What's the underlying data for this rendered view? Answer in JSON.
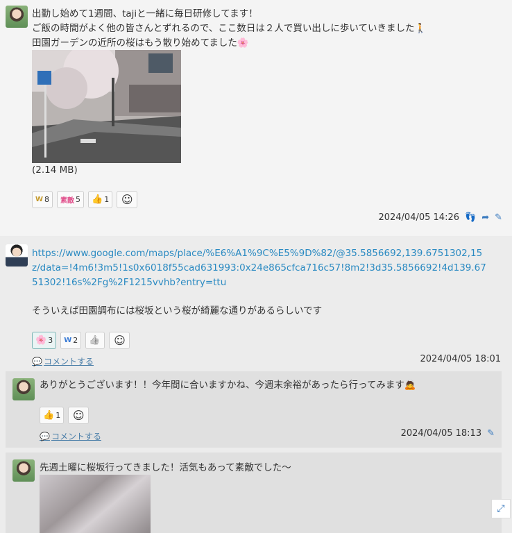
{
  "post1": {
    "lines": [
      "出勤し始めて1週間、tajiと一緒に毎日研修してます！",
      "ご飯の時間がよく他の皆さんとずれるので、ここ数日は２人で買い出しに歩いていきました🚶",
      "田園ガーデンの近所の桜はもう散り始めてました🌸"
    ],
    "file_size": "(2.14 MB)",
    "reactions": [
      {
        "emoji": "W",
        "count": "8"
      },
      {
        "emoji": "素敵",
        "count": "5"
      },
      {
        "emoji": "👍",
        "count": "1"
      }
    ],
    "add_reaction": "☺",
    "timestamp": "2024/04/05 14:26"
  },
  "post2": {
    "url": [
      "https://www.google.com/maps/place/%E6%A1%9C%E5%9D%82/@35.5856692,139.6751302,15",
      "z/data=!4m6!3m5!1s0x6018f55cad631993:0x24e865cfca716c57!8m2!3d35.5856692!4d139.67",
      "51302!16s%2Fg%2F1215vvhb?entry=ttu"
    ],
    "text": "そういえば田園調布には桜坂という桜が綺麗な通りがあるらしいです",
    "reactions": [
      {
        "emoji": "🌸",
        "count": "3"
      },
      {
        "emoji": "W",
        "count": "2"
      },
      {
        "emoji": "👍",
        "count": ""
      }
    ],
    "add_reaction": "☺",
    "comment_label": "コメントする",
    "timestamp": "2024/04/05 18:01"
  },
  "reply1": {
    "text": "ありがとうございます！！今年間に合いますかね、今週末余裕があったら行ってみます🙇",
    "reactions": [
      {
        "emoji": "👍",
        "count": "1"
      }
    ],
    "add_reaction": "☺",
    "comment_label": "コメントする",
    "timestamp": "2024/04/05 18:13"
  },
  "reply2": {
    "text": "先週土曜に桜坂行ってきました！活気もあって素敵でした〜"
  }
}
